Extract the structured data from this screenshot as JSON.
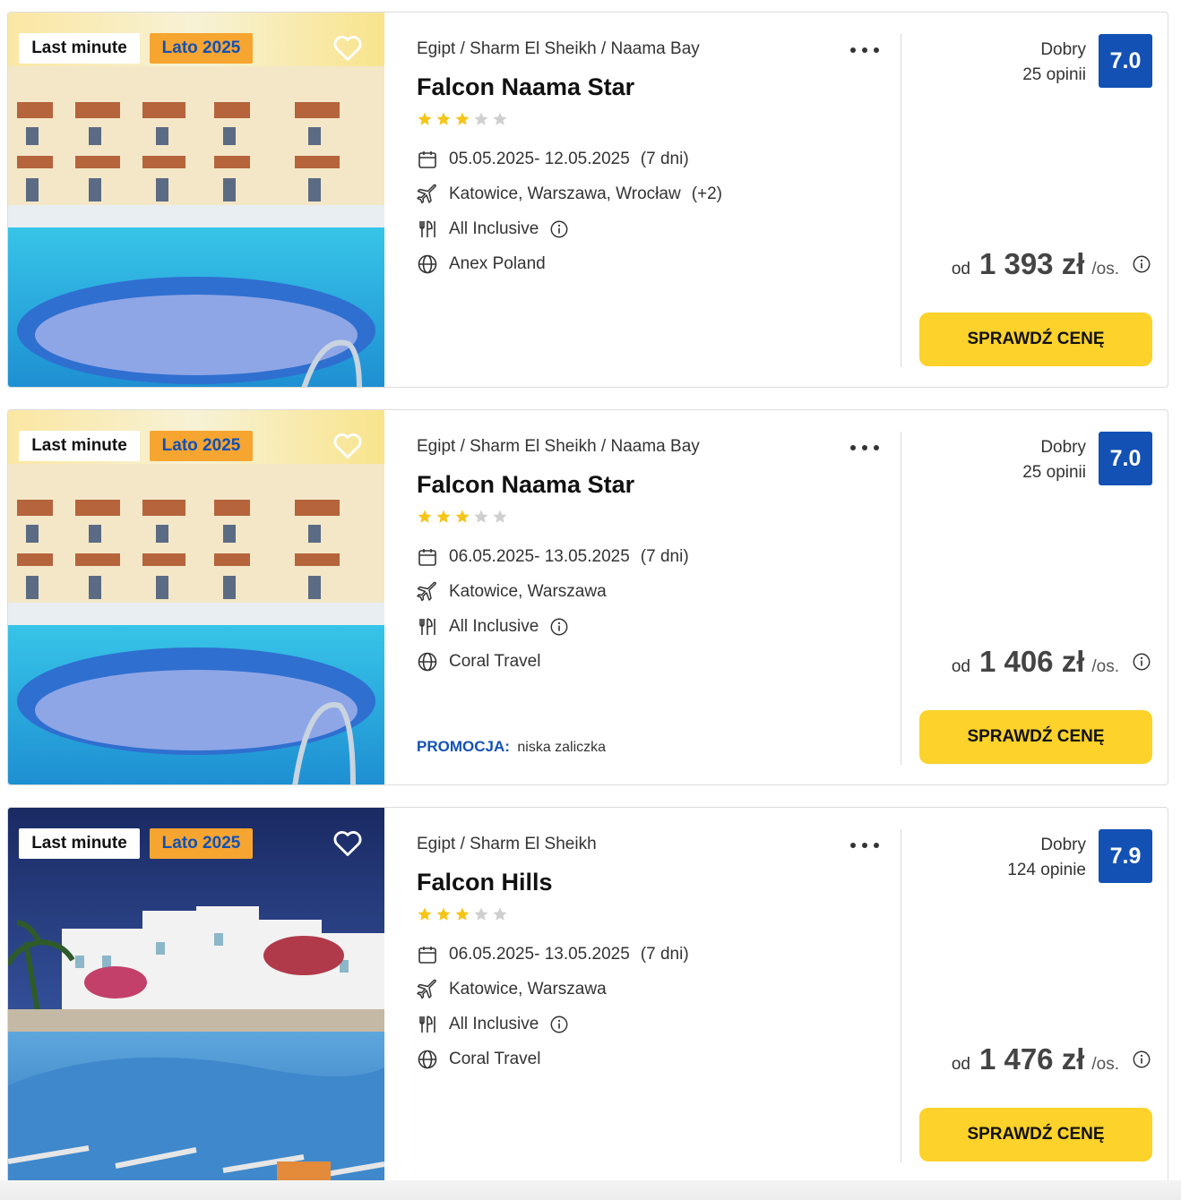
{
  "colors": {
    "accent_blue": "#1351b4",
    "badge_orange": "#f7a531",
    "cta_yellow": "#fdd22a",
    "star_filled": "#f5c518",
    "star_empty": "#cfcfcf"
  },
  "offers": [
    {
      "badges": {
        "last_minute": "Last minute",
        "season": "Lato 2025"
      },
      "breadcrumb": "Egipt / Sharm El Sheikh / Naama Bay",
      "name": "Falcon Naama Star",
      "stars_filled": 3,
      "stars_total": 5,
      "dates": "05.05.2025- 12.05.2025",
      "duration": "(7 dni)",
      "departure": "Katowice, Warszawa, Wrocław",
      "departure_more": "(+2)",
      "board": "All Inclusive",
      "operator": "Anex Poland",
      "promo_label": "",
      "promo_value": "",
      "rating_label": "Dobry",
      "reviews": "25 opinii",
      "score": "7.0",
      "price_prefix": "od",
      "price": "1 393 zł",
      "price_suffix": "/os.",
      "cta": "SPRAWDŹ CENĘ",
      "photo": "hotel-pool-terraces"
    },
    {
      "badges": {
        "last_minute": "Last minute",
        "season": "Lato 2025"
      },
      "breadcrumb": "Egipt / Sharm El Sheikh / Naama Bay",
      "name": "Falcon Naama Star",
      "stars_filled": 3,
      "stars_total": 5,
      "dates": "06.05.2025- 13.05.2025",
      "duration": "(7 dni)",
      "departure": "Katowice, Warszawa",
      "departure_more": "",
      "board": "All Inclusive",
      "operator": "Coral Travel",
      "promo_label": "PROMOCJA:",
      "promo_value": "niska zaliczka",
      "rating_label": "Dobry",
      "reviews": "25 opinii",
      "score": "7.0",
      "price_prefix": "od",
      "price": "1 406 zł",
      "price_suffix": "/os.",
      "cta": "SPRAWDŹ CENĘ",
      "photo": "hotel-pool-terraces"
    },
    {
      "badges": {
        "last_minute": "Last minute",
        "season": "Lato 2025"
      },
      "breadcrumb": "Egipt / Sharm El Sheikh",
      "name": "Falcon Hills",
      "stars_filled": 3,
      "stars_total": 5,
      "dates": "06.05.2025- 13.05.2025",
      "duration": "(7 dni)",
      "departure": "Katowice, Warszawa",
      "departure_more": "",
      "board": "All Inclusive",
      "operator": "Coral Travel",
      "promo_label": "",
      "promo_value": "",
      "rating_label": "Dobry",
      "reviews": "124 opinie",
      "score": "7.9",
      "price_prefix": "od",
      "price": "1 476 zł",
      "price_suffix": "/os.",
      "cta": "SPRAWDŹ CENĘ",
      "photo": "white-resort-pool-night"
    }
  ]
}
